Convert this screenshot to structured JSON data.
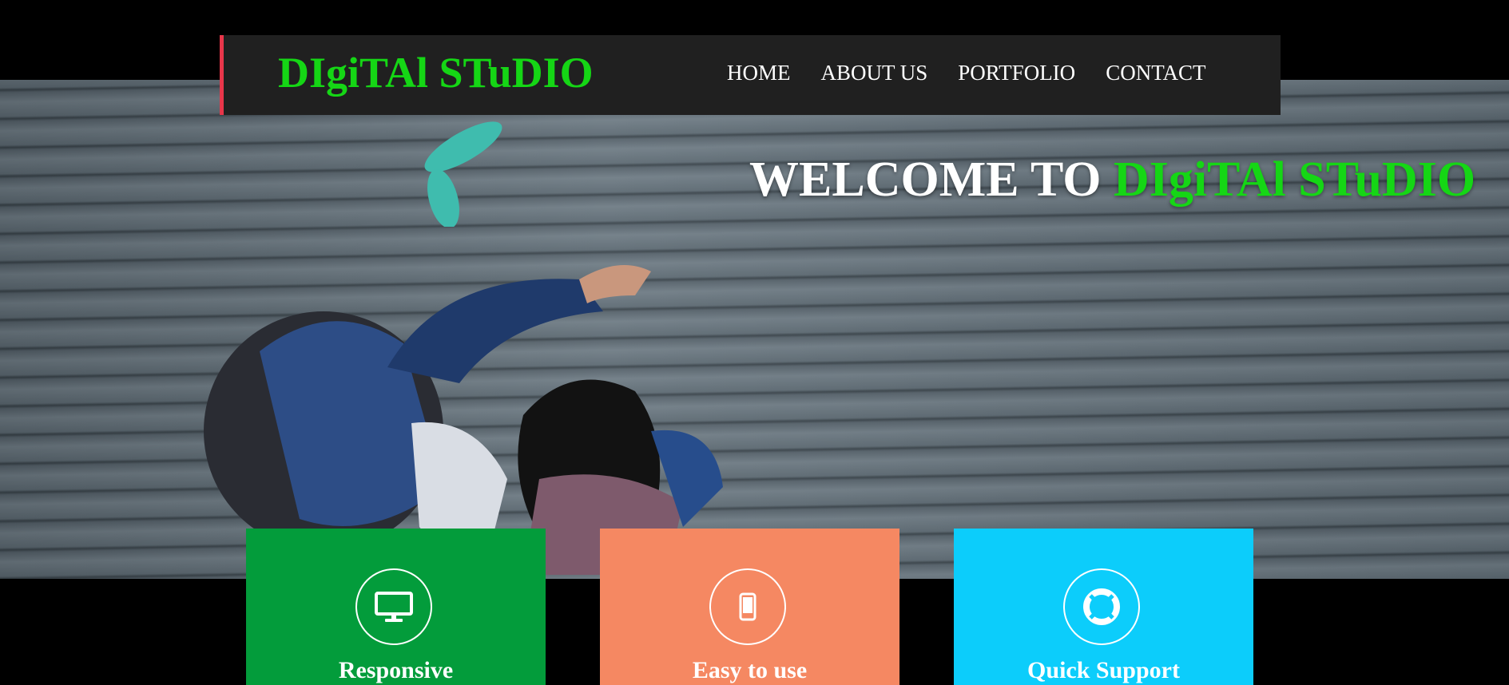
{
  "brand": {
    "logo_text": "DIgiTAl STuDIO",
    "logo_color": "#15d615",
    "accent_border": "#e8364a"
  },
  "nav": {
    "items": [
      "HOME",
      "ABOUT US",
      "PORTFOLIO",
      "CONTACT"
    ]
  },
  "hero": {
    "welcome_prefix": "WELCOME TO ",
    "welcome_brand": "DIgiTAl STuDIO",
    "image": "people-sitting-on-wooden-boardwalk"
  },
  "features": [
    {
      "label": "Responsive",
      "icon": "monitor-icon",
      "color": "#039c3b"
    },
    {
      "label": "Easy to use",
      "icon": "mobile-phone-icon",
      "color": "#f58862"
    },
    {
      "label": "Quick Support",
      "icon": "life-ring-icon",
      "color": "#0ccdfb"
    }
  ]
}
